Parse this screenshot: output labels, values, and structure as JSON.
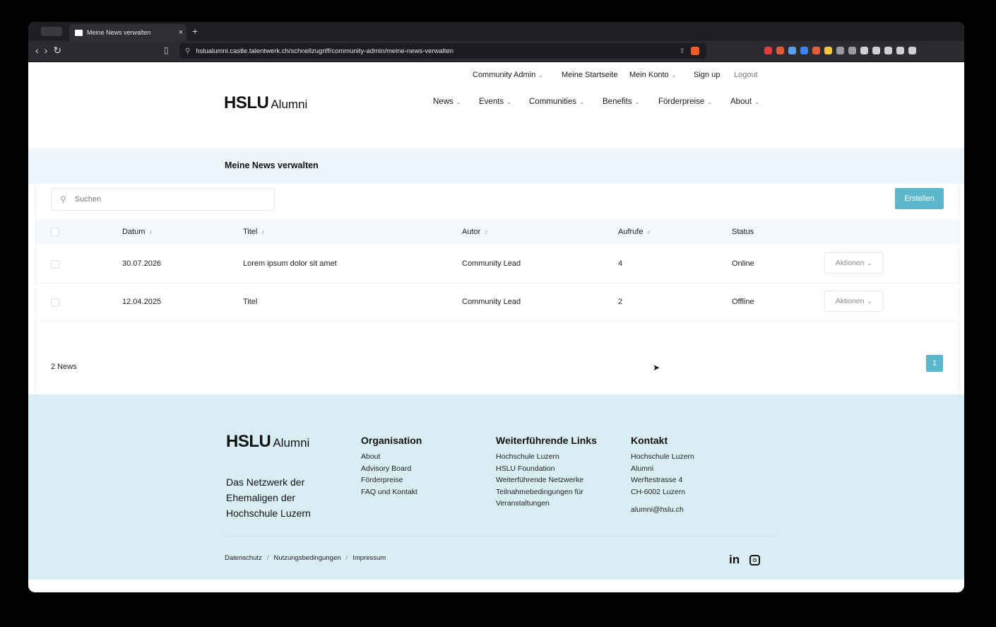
{
  "browser": {
    "tab_title": "Meine News verwalten",
    "tab_close": "×",
    "new_tab": "+",
    "url": "hslualumni.castle.talentwerk.ch/schnellzugriff/community-admin/meine-news-verwalten",
    "brand_color": "#f25c2a",
    "ext_colors": [
      "#e23b3b",
      "#e05a3a",
      "#5aa0e6",
      "#3b82f6",
      "#e55b3c",
      "#f5c542",
      "#9a9aa0",
      "#9a9aa0",
      "#cfcfd4",
      "#cfcfd4",
      "#cfcfd4",
      "#cfcfd4",
      "#cfcfd4"
    ]
  },
  "site": {
    "logo_hslu": "HSLU",
    "logo_alumni": "Alumni",
    "topnav": {
      "community_admin": "Community Admin",
      "startseite": "Meine Startseite",
      "konto": "Mein Konto",
      "signup": "Sign up",
      "logout": "Logout"
    },
    "mainnav": {
      "news": "News",
      "events": "Events",
      "communities": "Communities",
      "benefits": "Benefits",
      "foerderpreise": "Förderpreise",
      "about": "About"
    },
    "page_title": "Meine News verwalten",
    "accent_color": "#5bb7cc"
  },
  "manager": {
    "search_placeholder": "Suchen",
    "create_label": "Erstellen",
    "columns": {
      "datum": "Datum",
      "titel": "Titel",
      "autor": "Autor",
      "aufrufe": "Aufrufe",
      "status": "Status"
    },
    "rows": [
      {
        "datum": "30.07.2026",
        "titel": "Lorem ipsum dolor sit amet",
        "autor": "Community Lead",
        "aufrufe": "4",
        "status": "Online",
        "action": "Aktionen"
      },
      {
        "datum": "12.04.2025",
        "titel": "Titel",
        "autor": "Community Lead",
        "aufrufe": "2",
        "status": "Offline",
        "action": "Aktionen"
      }
    ],
    "count": "2 News",
    "page": "1"
  },
  "footer": {
    "logo_hslu": "HSLU",
    "logo_alumni": "Alumni",
    "tagline": "Das Netzwerk der Ehemaligen der Hochschule Luzern",
    "org": {
      "title": "Organisation",
      "links": [
        "About",
        "Advisory Board",
        "Förderpreise",
        "FAQ und Kontakt"
      ]
    },
    "links": {
      "title": "Weiterführende Links",
      "links": [
        "Hochschule Luzern",
        "HSLU Foundation",
        "Weiterführende Netzwerke",
        "Teilnahmebedingungen für",
        "Veranstaltungen"
      ]
    },
    "kontakt": {
      "title": "Kontakt",
      "lines": [
        "Hochschule Luzern",
        "Alumni",
        "Werftestrasse 4",
        "CH-6002 Luzern"
      ],
      "email": "alumni@hslu.ch"
    },
    "legal": {
      "datenschutz": "Datenschutz",
      "nutzung": "Nutzungsbedingungen",
      "impressum": "Impressum",
      "sep": "/"
    },
    "social": {
      "linkedin": "in"
    }
  }
}
